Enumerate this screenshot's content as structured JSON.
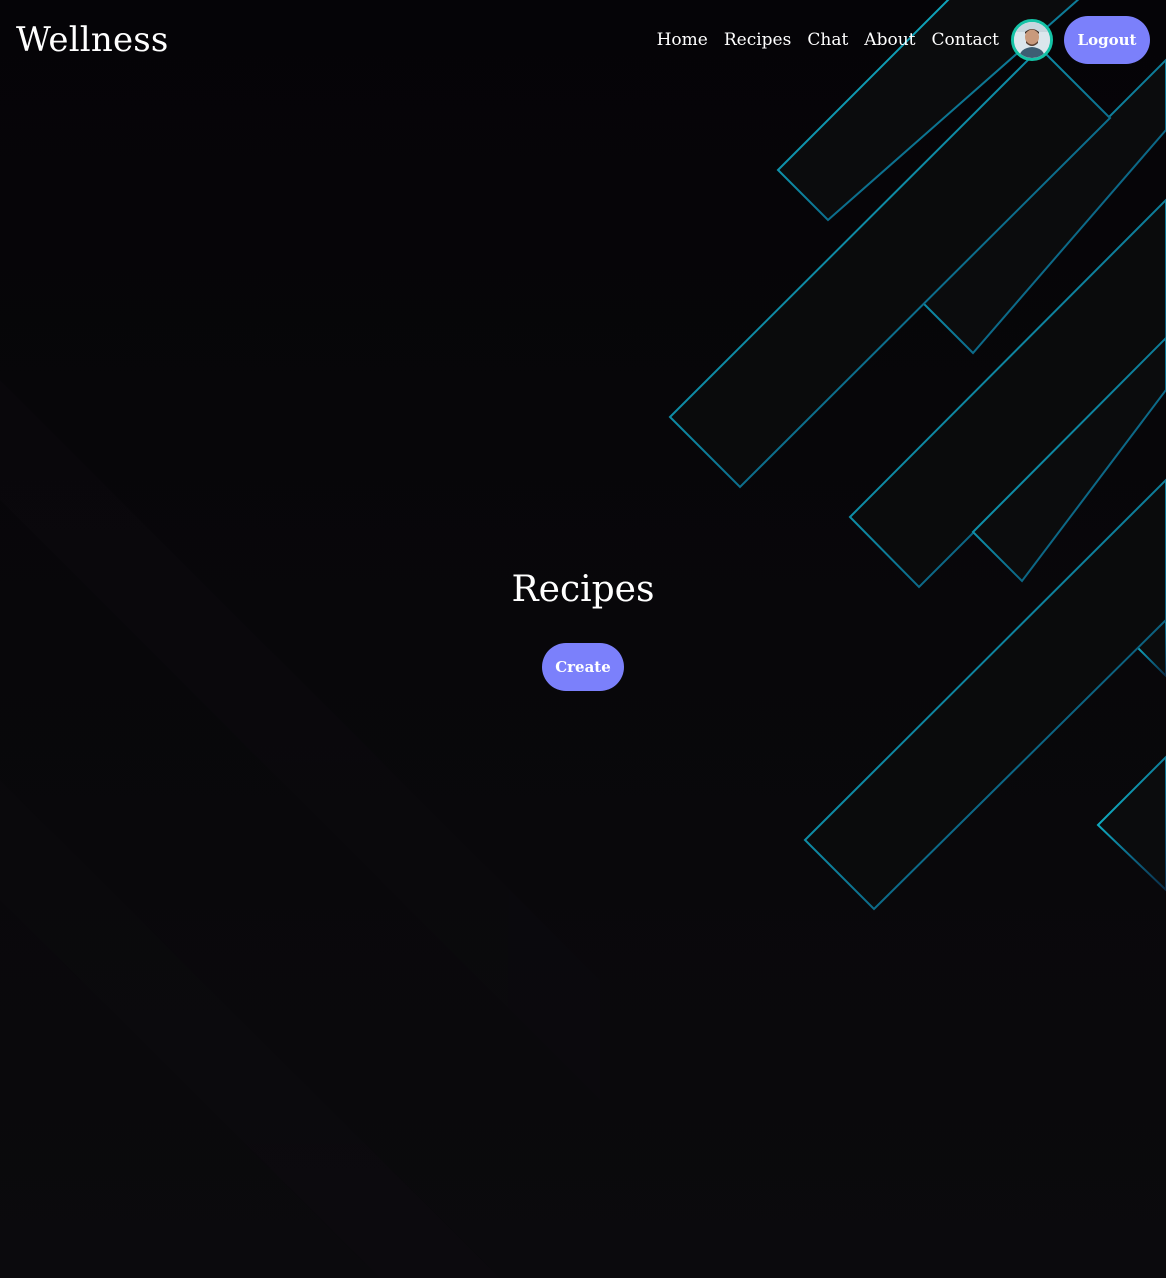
{
  "header": {
    "brand": "Wellness",
    "nav": {
      "home": "Home",
      "recipes": "Recipes",
      "chat": "Chat",
      "about": "About",
      "contact": "Contact"
    },
    "logout_label": "Logout"
  },
  "main": {
    "title": "Recipes",
    "create_label": "Create"
  },
  "theme": {
    "background": "#07060a",
    "accent": "#7b80fb",
    "neon": "#13d6e0",
    "avatar_ring": "#14c3a6"
  },
  "icons": {
    "avatar": "user-avatar-photo"
  }
}
